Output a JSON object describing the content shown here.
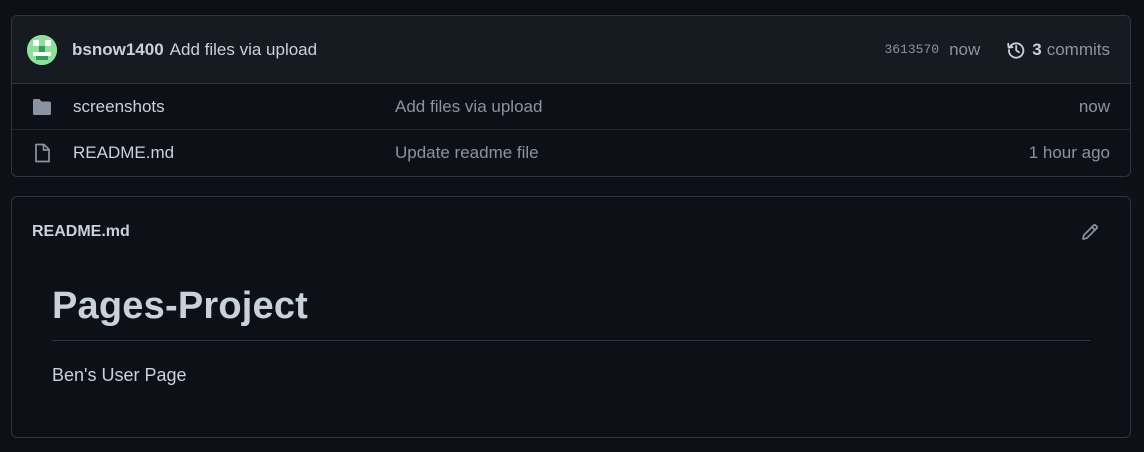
{
  "latest_commit": {
    "author": "bsnow1400",
    "message": "Add files via upload",
    "sha": "3613570",
    "time": "now",
    "commits_count": "3",
    "commits_label": "commits",
    "avatar_color": "#8ee09a"
  },
  "files": [
    {
      "icon": "folder-icon",
      "name": "screenshots",
      "commit_message": "Add files via upload",
      "age": "now"
    },
    {
      "icon": "file-icon",
      "name": "README.md",
      "commit_message": "Update readme file",
      "age": "1 hour ago"
    }
  ],
  "readme": {
    "filename": "README.md",
    "heading": "Pages-Project",
    "paragraph": "Ben's User Page"
  },
  "colors": {
    "background": "#0d1117",
    "header_bg": "#161b22",
    "border": "#30363d",
    "text": "#c9d1d9",
    "muted": "#8b949e"
  }
}
